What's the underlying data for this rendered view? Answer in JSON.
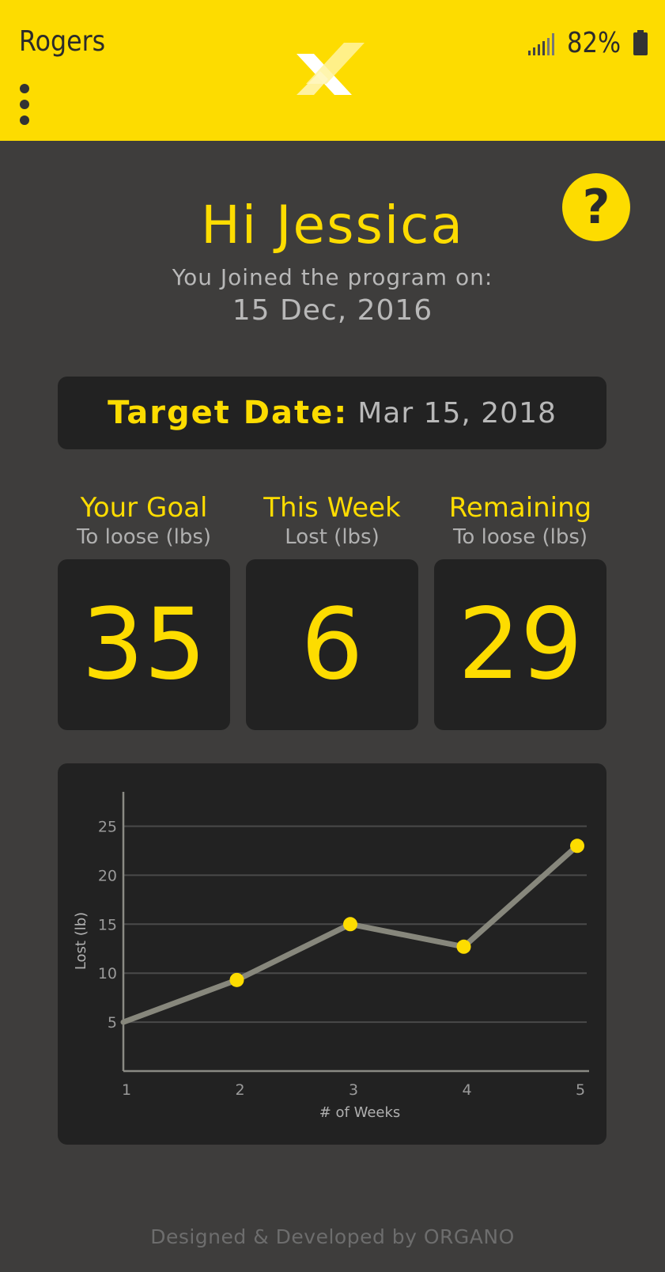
{
  "status_bar": {
    "carrier": "Rogers",
    "battery_percent": "82%"
  },
  "header": {
    "logo_icon": "x-logo-icon",
    "menu_icon": "vertical-dots-menu-icon",
    "accent_color": "#fddc00"
  },
  "greeting": {
    "title": "Hi Jessica",
    "joined_label": "You Joined the program on:",
    "joined_date": "15 Dec, 2016",
    "help_label": "?"
  },
  "target": {
    "label": "Target Date:",
    "value": "Mar 15, 2018"
  },
  "stats": [
    {
      "title": "Your Goal",
      "subtitle": "To loose (lbs)",
      "value": "35"
    },
    {
      "title": "This Week",
      "subtitle": "Lost (lbs)",
      "value": "6"
    },
    {
      "title": "Remaining",
      "subtitle": "To loose (lbs)",
      "value": "29"
    }
  ],
  "chart_data": {
    "type": "line",
    "x": [
      1,
      2,
      3,
      4,
      5
    ],
    "series": [
      {
        "values": [
          5,
          9.3,
          15,
          12.7,
          23
        ]
      }
    ],
    "xlabel": "# of Weeks",
    "ylabel": "Lost (lb)",
    "x_ticks": [
      "1",
      "2",
      "3",
      "4",
      "5"
    ],
    "y_ticks": [
      "5",
      "10",
      "15",
      "20",
      "25"
    ],
    "xlim": [
      1,
      5
    ],
    "ylim": [
      0,
      29
    ],
    "grid": true,
    "line_color": "#87877c",
    "point_color": "#fddc00"
  },
  "footer": {
    "text": "Designed & Developed by ORGANO"
  }
}
